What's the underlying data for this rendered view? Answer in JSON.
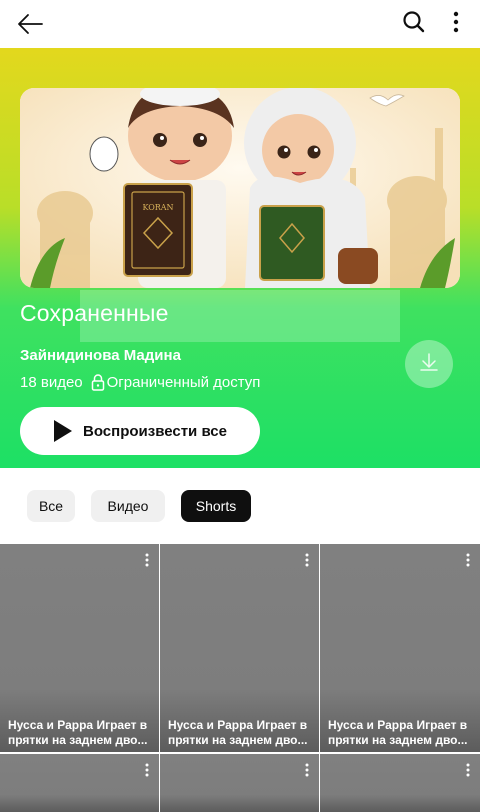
{
  "topbar": {
    "back_icon": "arrow-left-icon",
    "search_icon": "search-icon",
    "more_icon": "more-vertical-icon"
  },
  "playlist": {
    "title": "Сохраненные",
    "owner": "Зайнидинова Мадина",
    "count": "18 видео",
    "access": "Ограниченный доступ",
    "play_all_label": "Воспроизвести все",
    "thumbnail_text": "KORAN",
    "gradient_colors": [
      "#e3d81d",
      "#1de065"
    ]
  },
  "chips": [
    {
      "label": "Все",
      "active": false
    },
    {
      "label": "Видео",
      "active": false
    },
    {
      "label": "Shorts",
      "active": true
    }
  ],
  "shorts": [
    {
      "title": "Нусса и Рарра Играет в прятки на заднем дво..."
    },
    {
      "title": "Нусса и Рарра Играет в прятки на заднем дво..."
    },
    {
      "title": "Нусса и Рарра Играет в прятки на заднем дво..."
    },
    {
      "title": ""
    },
    {
      "title": ""
    },
    {
      "title": ""
    }
  ]
}
